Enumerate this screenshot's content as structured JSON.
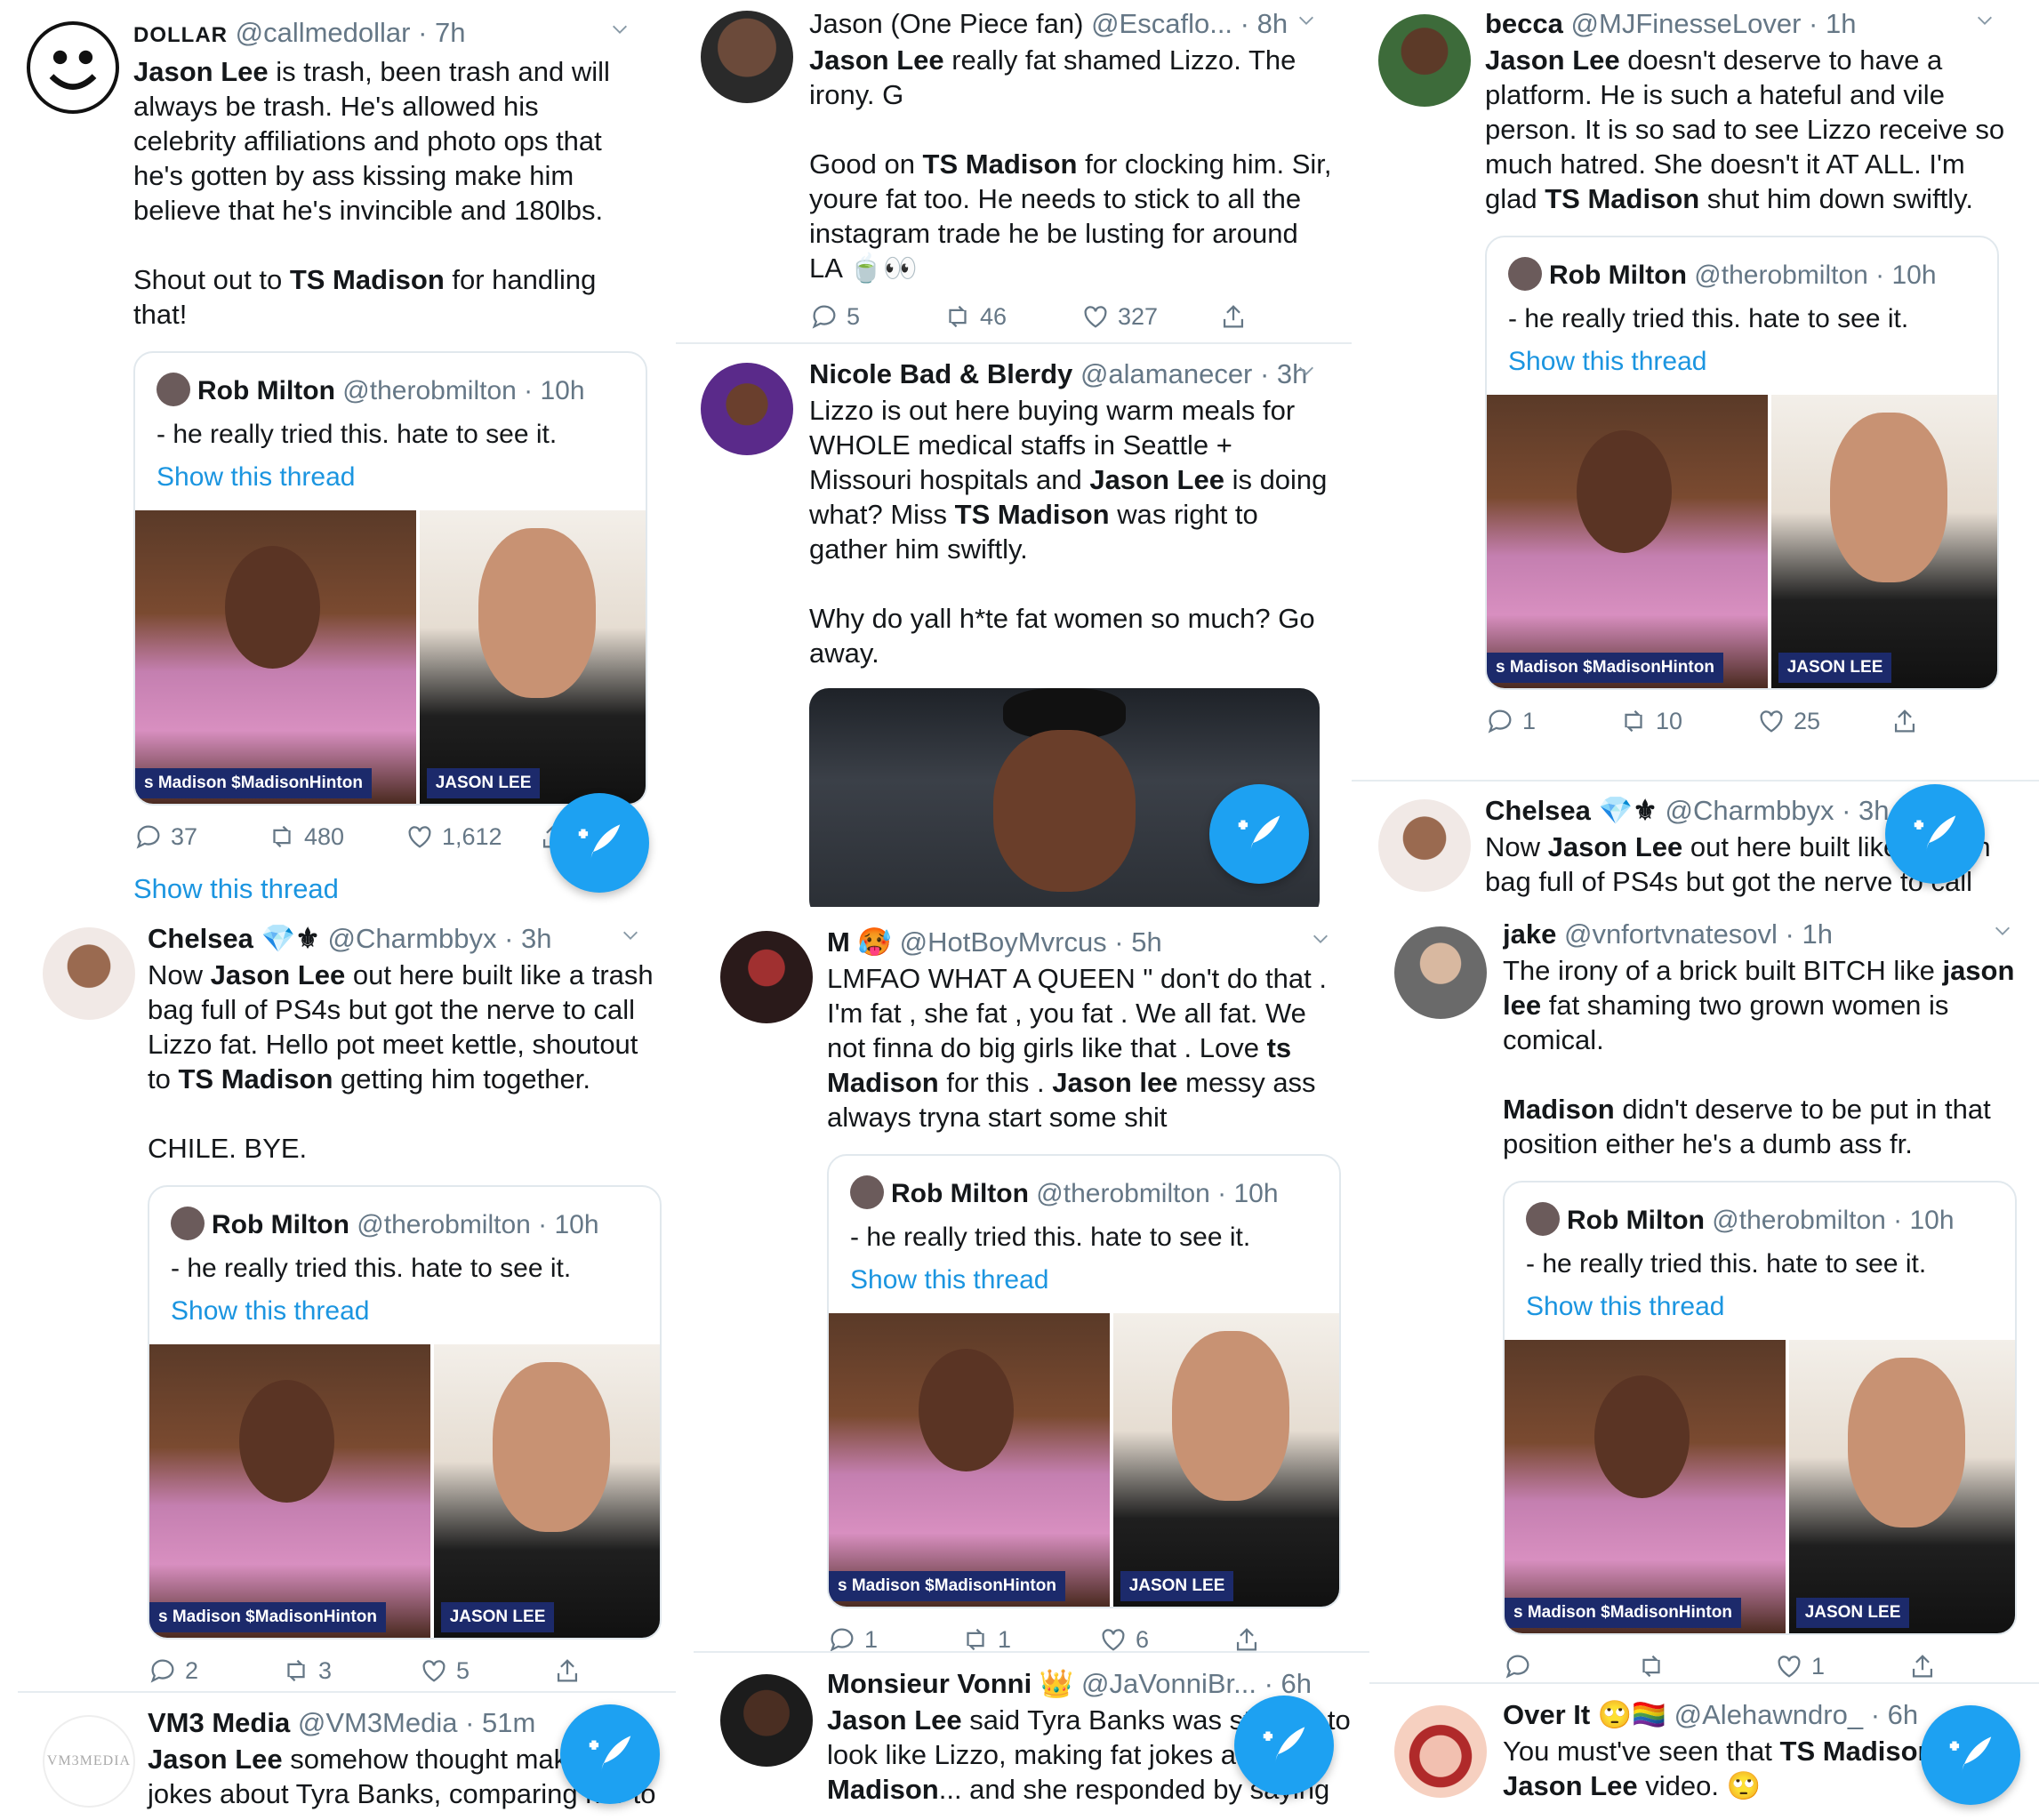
{
  "quote": {
    "name": "Rob Milton",
    "handle": "@therobmilton · 10h",
    "text": "- he really tried this. hate to see it.",
    "link": "Show this thread",
    "caption_left": "s Madison $MadisonHinton",
    "caption_right": "JASON LEE"
  },
  "show_thread": "Show this thread",
  "tweets": {
    "dollar": {
      "name": "DOLLAR",
      "handle": "@callmedollar · 7h",
      "p1": "Jason Lee",
      "p2": " is trash, been trash and will always be trash. He's allowed his celebrity affiliations and photo ops that he's gotten by ass kissing make him believe that he's invincible and 180lbs.\n\nShout out to ",
      "p3": "TS Madison",
      "p4": " for handling that!",
      "replies": "37",
      "retweets": "480",
      "likes": "1,612"
    },
    "jason_op": {
      "name": "Jason (One Piece fan)",
      "handle": "@Escaflo... · 8h",
      "p1": "Jason Lee",
      "p2": " really fat shamed Lizzo. The irony. G\n\nGood on ",
      "p3": "TS Madison",
      "p4": " for clocking him. Sir, youre fat too. He needs to stick to all the instagram trade he be lusting for around LA 🍵👀",
      "replies": "5",
      "retweets": "46",
      "likes": "327"
    },
    "nicole": {
      "name": "Nicole Bad & Blerdy",
      "handle": "@alamanecer · 3h",
      "p1": "Lizzo is out here buying warm meals for WHOLE medical staffs in Seattle + Missouri hospitals and ",
      "p2": "Jason Lee",
      "p3": " is doing what? Miss ",
      "p4": "TS Madison",
      "p5": " was right to gather him swiftly.\n\nWhy do yall h*te fat women so much? Go away."
    },
    "becca": {
      "name": "becca",
      "handle": "@MJFinesseLover · 1h",
      "p1": "Jason Lee",
      "p2": " doesn't deserve to have a platform. He is such a hateful and vile person. It is so sad to see Lizzo receive so much hatred. She doesn't it AT ALL. I'm glad ",
      "p3": "TS Madison",
      "p4": " shut him down swiftly.",
      "replies": "1",
      "retweets": "10",
      "likes": "25"
    },
    "chelsea_peek": {
      "name": "Chelsea 💎⚜",
      "handle": "@Charmbbyx · 3h",
      "p1": "Now ",
      "p2": "Jason Lee",
      "p3": " out here built like a trash bag full of PS4s but got the nerve to call"
    },
    "chelsea": {
      "name": "Chelsea 💎⚜",
      "handle": "@Charmbbyx · 3h",
      "p1": "Now ",
      "p2": "Jason Lee",
      "p3": " out here built like a trash bag full of PS4s but got the nerve to call Lizzo fat. Hello pot meet kettle, shoutout to ",
      "p4": "TS Madison",
      "p5": " getting him together.\n\nCHILE. BYE.",
      "replies": "2",
      "retweets": "3",
      "likes": "5"
    },
    "vm3": {
      "name": "VM3 Media",
      "handle": "@VM3Media · 51m",
      "avatar_text": "VM3MEDIA",
      "p1": "Jason Lee",
      "p2": " somehow thought making jokes about Tyra Banks, comparing her to"
    },
    "m": {
      "name": "M 🥵",
      "handle": "@HotBoyMvrcus · 5h",
      "p1": "LMFAO WHAT A QUEEN \" don't do that . I'm fat , she fat , you fat . We all fat. We not finna do big girls like that . Love ",
      "p2": "ts Madison",
      "p3": " for this . ",
      "p4": "Jason lee",
      "p5": " messy ass always tryna start some shit",
      "replies": "1",
      "retweets": "1",
      "likes": "6"
    },
    "monsieur": {
      "name": "Monsieur Vonni 👑",
      "handle": "@JaVonniBr... · 6h",
      "p1": "Jason Lee",
      "p2": " said Tyra Banks was starting to look like Lizzo, making fat jokes at ",
      "p3": "Madison",
      "p4": "... and she responded by saying"
    },
    "jake": {
      "name": "jake",
      "handle": "@vnfortvnatesovl · 1h",
      "p1": "The irony of a brick built BITCH like ",
      "p2": "jason lee",
      "p3": " fat shaming two grown women is comical.\n\n",
      "p4": "Madison",
      "p5": " didn't deserve to be put in that position either he's a dumb ass fr.",
      "replies": "",
      "retweets": "",
      "likes": "1"
    },
    "overit": {
      "name": "Over It 🙄🏳️‍🌈",
      "handle": "@Alehawndro_ · 6h",
      "p1": "You must've seen that ",
      "p2": "TS Madison",
      "p3": " and ",
      "p4": "Jason Lee",
      "p5": " video. 🙄"
    }
  },
  "colors": {
    "link": "#1b95e0",
    "fab": "#1da1f2",
    "muted": "#657786"
  }
}
